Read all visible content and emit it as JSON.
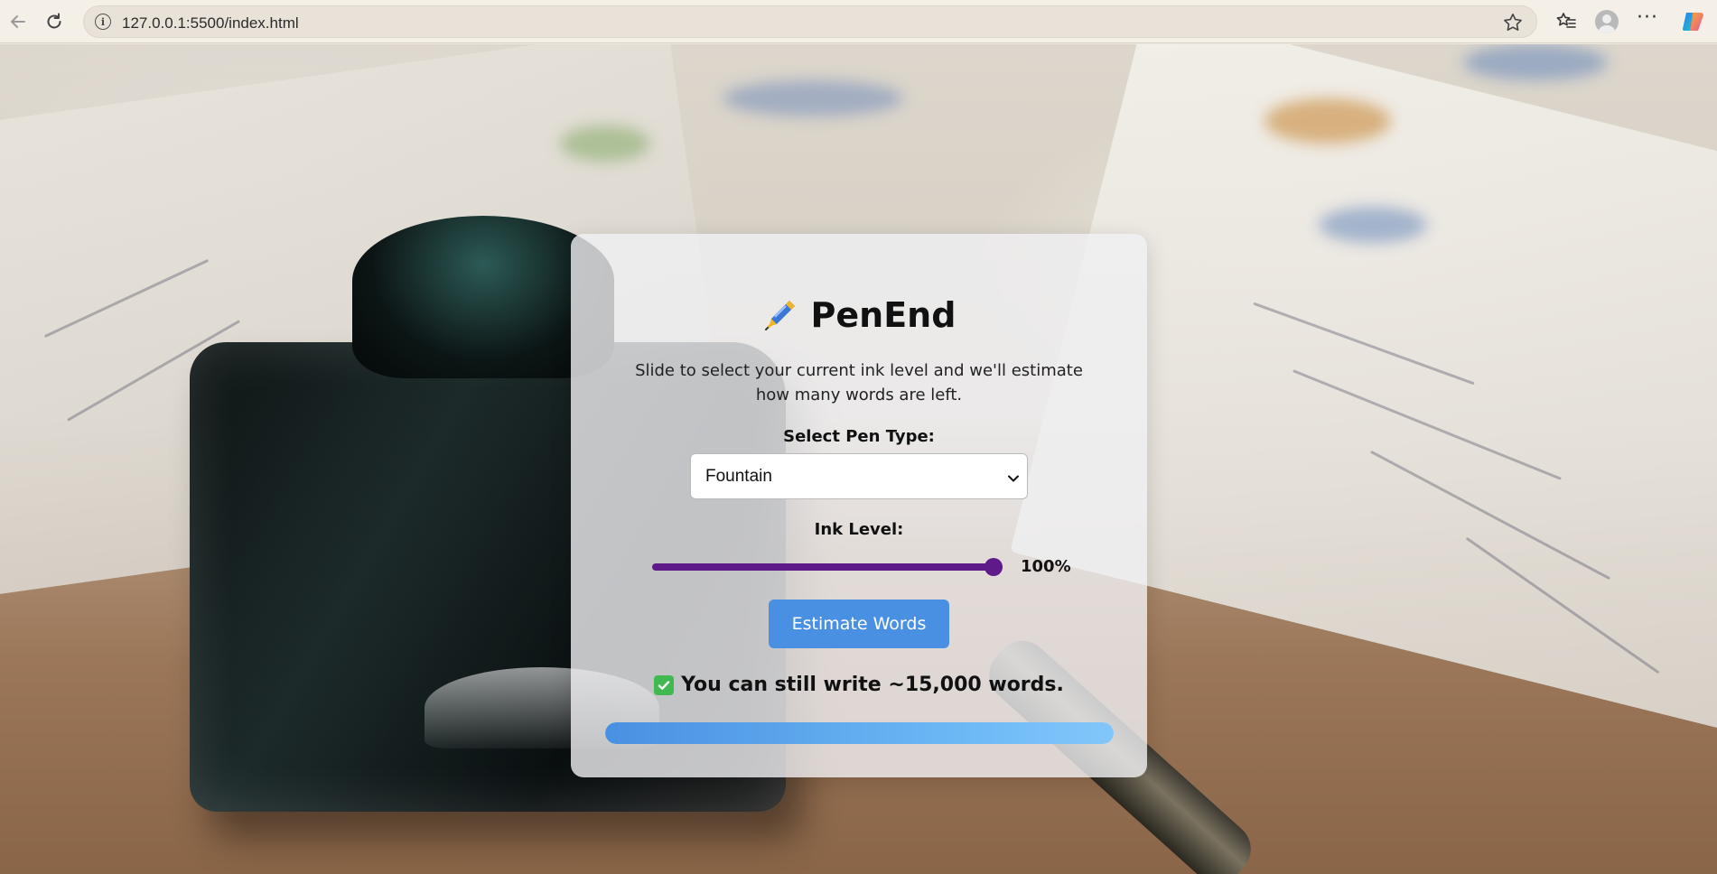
{
  "browser": {
    "url": "127.0.0.1:5500/index.html",
    "icons": [
      "back-icon",
      "reload-icon",
      "info-icon",
      "star-icon",
      "favorites-icon",
      "profile-icon",
      "more-icon",
      "copilot-icon"
    ]
  },
  "app": {
    "title": "PenEnd",
    "title_icon": "fountain-pen-icon",
    "subtitle": "Slide to select your current ink level and we'll estimate how many words are left.",
    "pen_type": {
      "label": "Select Pen Type:",
      "selected": "Fountain"
    },
    "ink_level": {
      "label": "Ink Level:",
      "value": 100,
      "display": "100%"
    },
    "estimate_button": "Estimate Words",
    "result": {
      "icon": "check-mark-icon",
      "text": "You can still write ~15,000 words."
    },
    "progress": {
      "fraction": 1.0
    }
  },
  "colors": {
    "slider": "#5f1a8a",
    "button": "#4a90e2",
    "progress_start": "#4a90e2",
    "progress_end": "#82c7fb",
    "check": "#3fb950"
  }
}
